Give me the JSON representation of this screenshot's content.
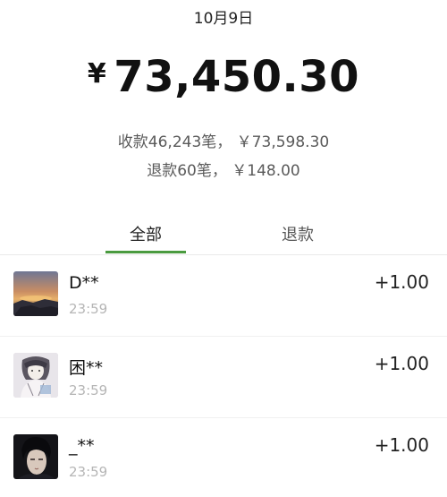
{
  "header": {
    "date": "10月9日",
    "currency_symbol": "¥",
    "total_amount": "73,450.30",
    "income_summary": "收款46,243笔， ￥73,598.30",
    "refund_summary": "退款60笔， ￥148.00"
  },
  "tabs": [
    {
      "label": "全部",
      "active": true
    },
    {
      "label": "退款",
      "active": false
    }
  ],
  "colors": {
    "active_tab_indicator": "#4a9b3f",
    "time_text": "#b5b5b5",
    "summary_text": "#5a5a5a"
  },
  "transactions": [
    {
      "name": "D**",
      "time": "23:59",
      "amount": "+1.00",
      "avatar": "sunset-photo"
    },
    {
      "name": "困**",
      "time": "23:59",
      "amount": "+1.00",
      "avatar": "anime-sketch"
    },
    {
      "name": "_**",
      "time": "23:59",
      "amount": "+1.00",
      "avatar": "portrait-photo"
    }
  ]
}
